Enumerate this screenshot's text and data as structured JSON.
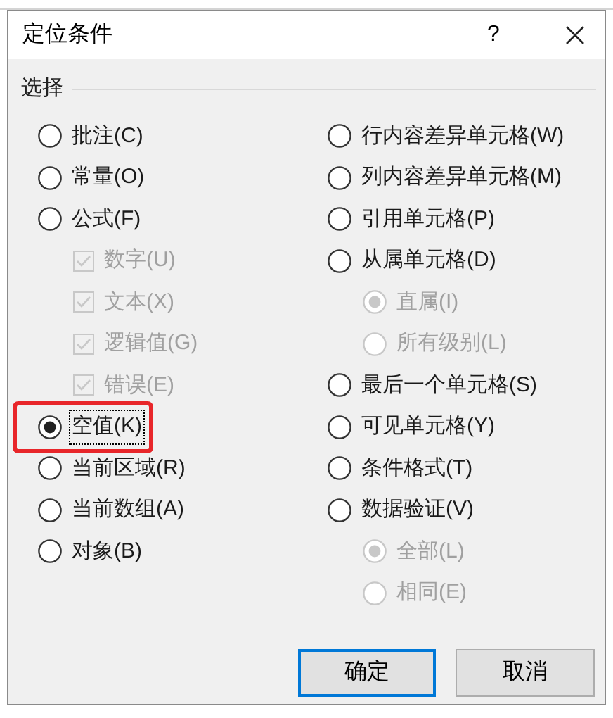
{
  "window": {
    "title": "定位条件",
    "help": "?"
  },
  "group": {
    "title": "选择"
  },
  "left": [
    {
      "label": "批注(C)",
      "selected": false,
      "focused": false,
      "highlighted": false
    },
    {
      "label": "常量(O)",
      "selected": false,
      "focused": false,
      "highlighted": false
    },
    {
      "label": "公式(F)",
      "selected": false,
      "focused": false,
      "highlighted": false,
      "children": [
        {
          "label": "数字(U)",
          "checked": true,
          "disabled": true
        },
        {
          "label": "文本(X)",
          "checked": true,
          "disabled": true
        },
        {
          "label": "逻辑值(G)",
          "checked": true,
          "disabled": true
        },
        {
          "label": "错误(E)",
          "checked": true,
          "disabled": true
        }
      ]
    },
    {
      "label": "空值(K)",
      "selected": true,
      "focused": true,
      "highlighted": true
    },
    {
      "label": "当前区域(R)",
      "selected": false,
      "focused": false,
      "highlighted": false
    },
    {
      "label": "当前数组(A)",
      "selected": false,
      "focused": false,
      "highlighted": false
    },
    {
      "label": "对象(B)",
      "selected": false,
      "focused": false,
      "highlighted": false
    }
  ],
  "right": [
    {
      "label": "行内容差异单元格(W)",
      "selected": false
    },
    {
      "label": "列内容差异单元格(M)",
      "selected": false
    },
    {
      "label": "引用单元格(P)",
      "selected": false
    },
    {
      "label": "从属单元格(D)",
      "selected": false,
      "children": [
        {
          "label": "直属(I)",
          "selected": true,
          "disabled": true
        },
        {
          "label": "所有级别(L)",
          "selected": false,
          "disabled": true
        }
      ]
    },
    {
      "label": "最后一个单元格(S)",
      "selected": false
    },
    {
      "label": "可见单元格(Y)",
      "selected": false
    },
    {
      "label": "条件格式(T)",
      "selected": false
    },
    {
      "label": "数据验证(V)",
      "selected": false,
      "children": [
        {
          "label": "全部(L)",
          "selected": true,
          "disabled": true
        },
        {
          "label": "相同(E)",
          "selected": false,
          "disabled": true
        }
      ]
    }
  ],
  "buttons": [
    {
      "label": "确定",
      "default": true
    },
    {
      "label": "取消",
      "default": false
    }
  ]
}
